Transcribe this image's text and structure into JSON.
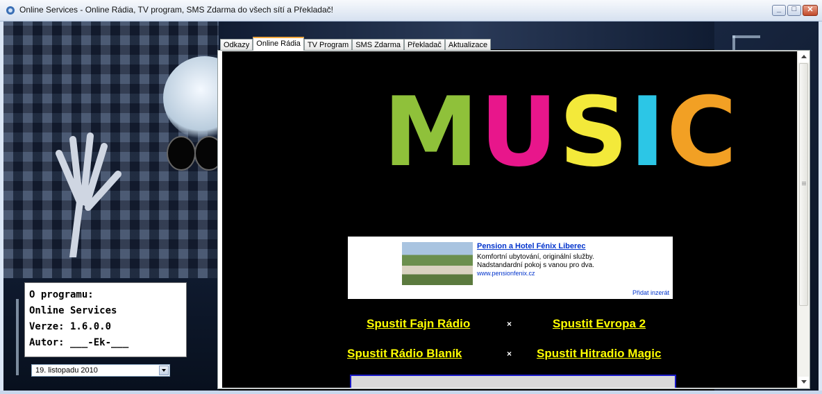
{
  "window": {
    "title": "Online Services - Online Rádia, TV program, SMS Zdarma do všech sítí a Překladač!"
  },
  "tabs": [
    {
      "label": "Odkazy"
    },
    {
      "label": "Online Rádia"
    },
    {
      "label": "TV Program"
    },
    {
      "label": "SMS Zdarma"
    },
    {
      "label": "Překladač"
    },
    {
      "label": "Aktualizace"
    }
  ],
  "active_tab": "Online Rádia",
  "logo": {
    "text": "MUSIC",
    "colors": [
      "#8fc13a",
      "#e8168b",
      "#f3e93a",
      "#2cc6e6",
      "#f2a024"
    ]
  },
  "ad": {
    "title": "Pension a Hotel Fénix Liberec",
    "line1": "Komfortní ubytování, originální služby.",
    "line2": "Nadstandardní pokoj s vanou pro dva.",
    "url": "www.pensionfenix.cz",
    "add_link": "Přidat inzerát"
  },
  "radios": {
    "r1": "Spustit Fajn Rádio",
    "r2": "Spustit Evropa 2",
    "r3": "Spustit Rádio Blaník",
    "r4": "Spustit Hitradio Magic",
    "separator": "×"
  },
  "info": {
    "heading": "O programu:",
    "name": "Online Services",
    "version": "Verze: 1.6.0.0",
    "author": "Autor: ___-Ek-___"
  },
  "date": {
    "value": "19. listopadu 2010"
  },
  "colors": {
    "link_yellow": "#ffff00",
    "tab_highlight": "#f3a93f"
  }
}
